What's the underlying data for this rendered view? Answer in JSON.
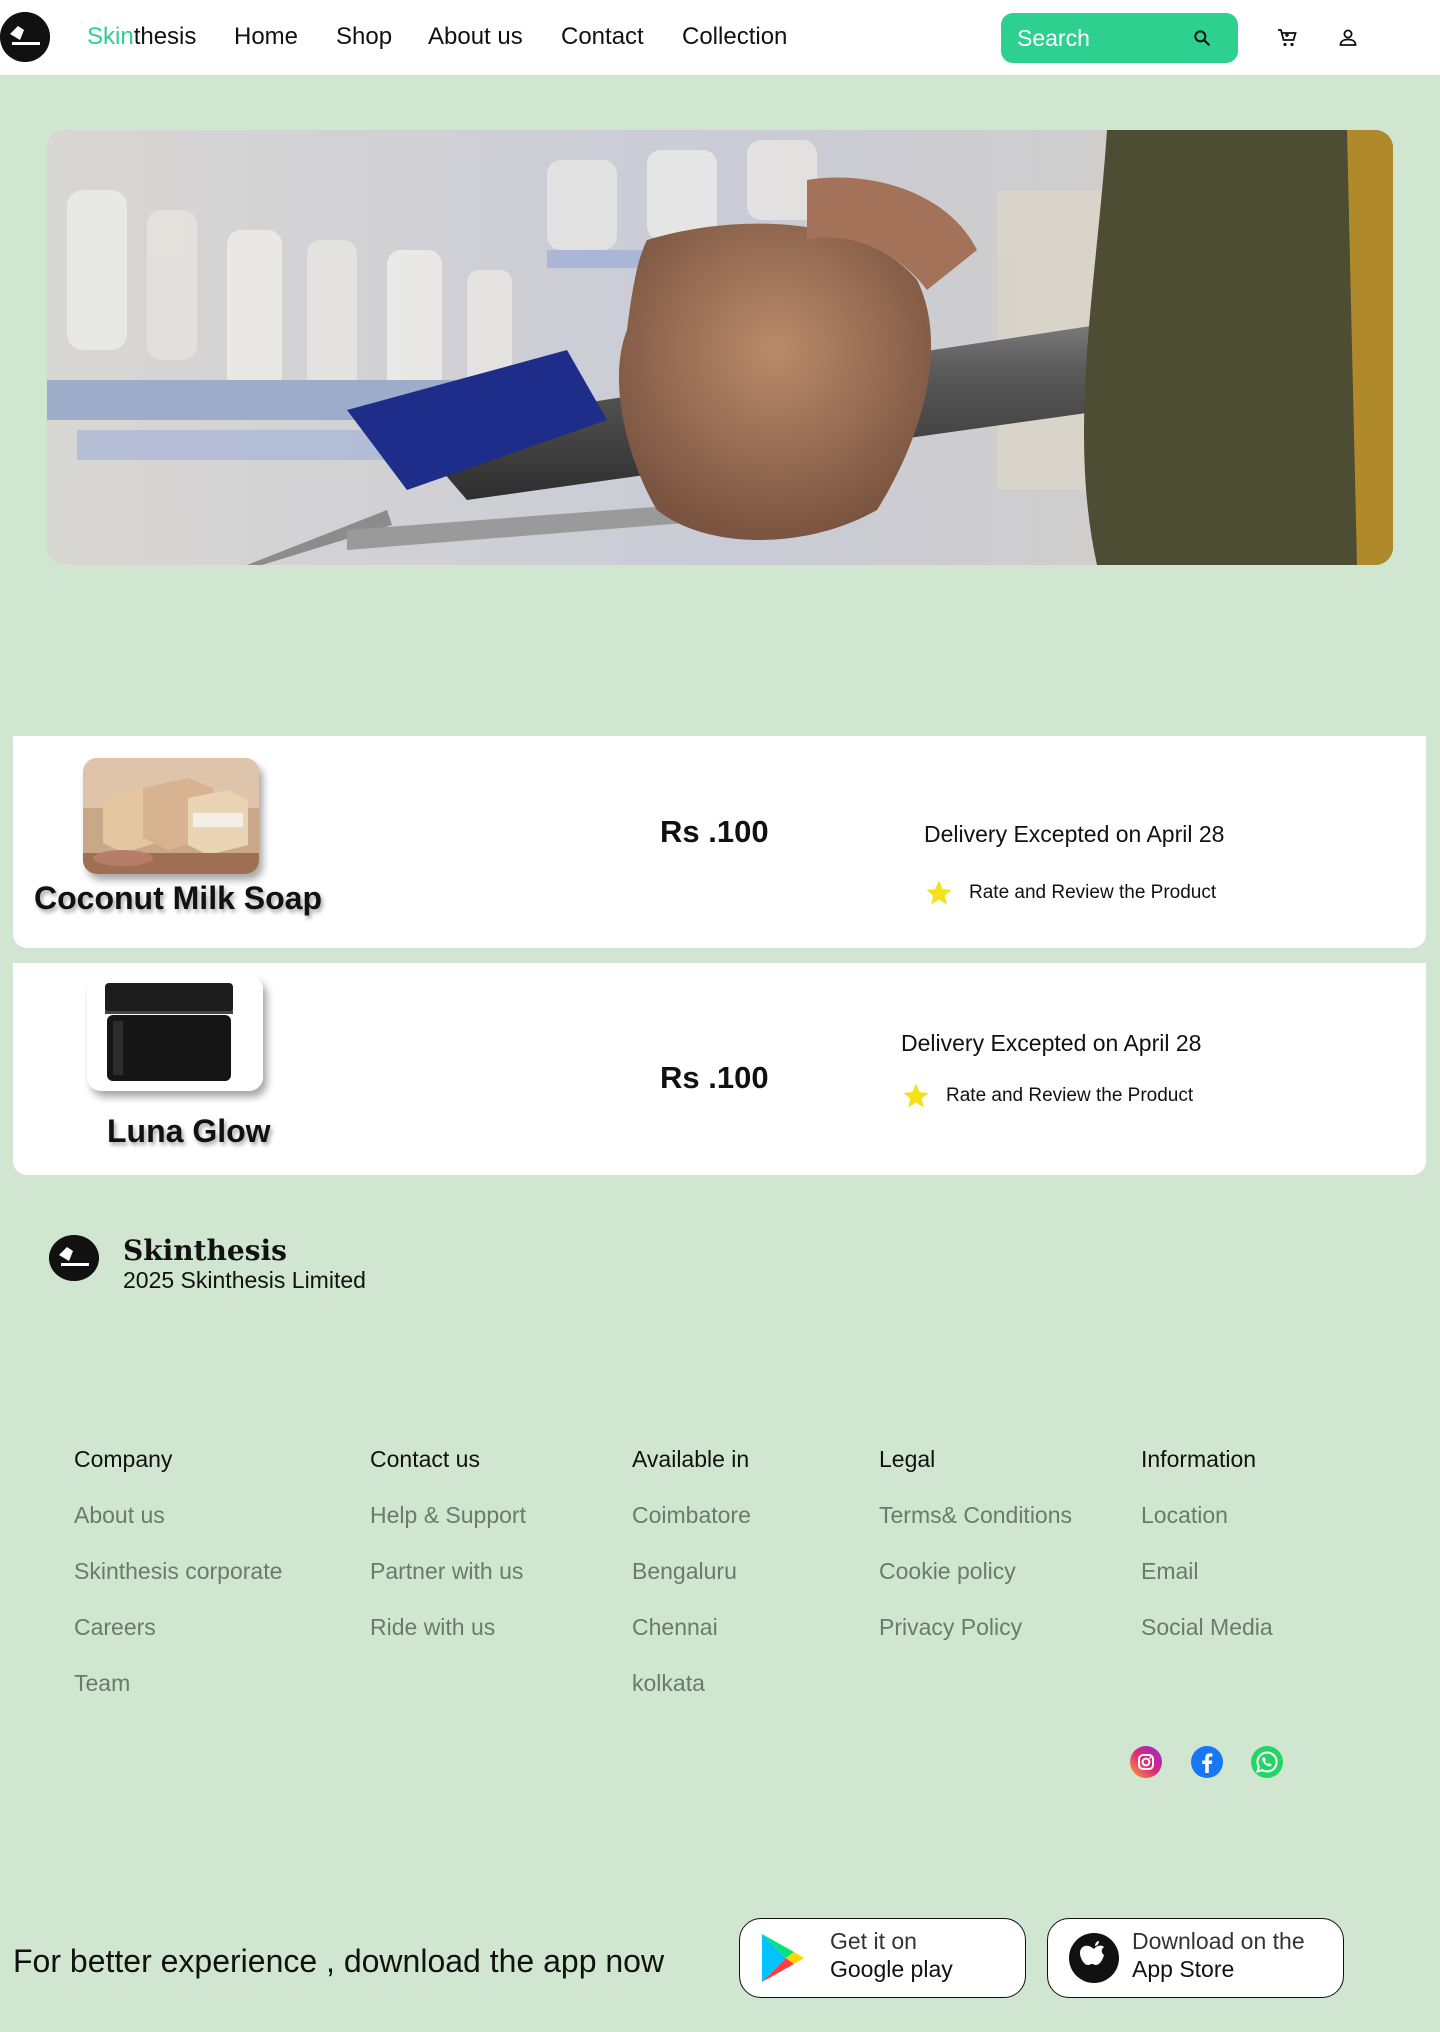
{
  "nav": {
    "brand_accent": "Skin",
    "brand_rest": "thesis",
    "links": [
      "Home",
      "Shop",
      "About us",
      "Contact",
      "Collection"
    ],
    "search_placeholder": "Search"
  },
  "orders": [
    {
      "name": "Coconut Milk Soap",
      "price": "Rs .100",
      "delivery": "Delivery Excepted on April 28",
      "rate_label": "Rate and Review the Product",
      "image": "soap-bars"
    },
    {
      "name": "Luna Glow",
      "price": "Rs .100",
      "delivery": "Delivery Excepted on April 28",
      "rate_label": "Rate and Review the Product",
      "image": "black-jar"
    }
  ],
  "footer": {
    "brand": "Skinthesis",
    "copyright": "2025 Skinthesis Limited",
    "columns": [
      {
        "heading": "Company",
        "links": [
          "About us",
          "Skinthesis corporate",
          "Careers",
          "Team"
        ]
      },
      {
        "heading": "Contact us",
        "links": [
          "Help & Support",
          "Partner with us",
          "Ride with us"
        ]
      },
      {
        "heading": "Available in",
        "links": [
          "Coimbatore",
          "Bengaluru",
          "Chennai",
          "kolkata"
        ]
      },
      {
        "heading": "Legal",
        "links": [
          "Terms& Conditions",
          "Cookie policy",
          "Privacy Policy"
        ]
      },
      {
        "heading": "Information",
        "links": [
          "Location",
          "Email",
          "Social Media"
        ]
      }
    ],
    "social": [
      "instagram-icon",
      "facebook-icon",
      "whatsapp-icon"
    ]
  },
  "app": {
    "prompt": "For better experience , download the app now",
    "google": {
      "small": "Get it on",
      "big": "Google play"
    },
    "apple": {
      "small": "Download on the",
      "big": "App Store"
    }
  },
  "colors": {
    "accent": "#2ed08f",
    "page_bg": "#d0e6d0",
    "link_grey": "#6b7a6b",
    "star": "#f4e11c"
  }
}
